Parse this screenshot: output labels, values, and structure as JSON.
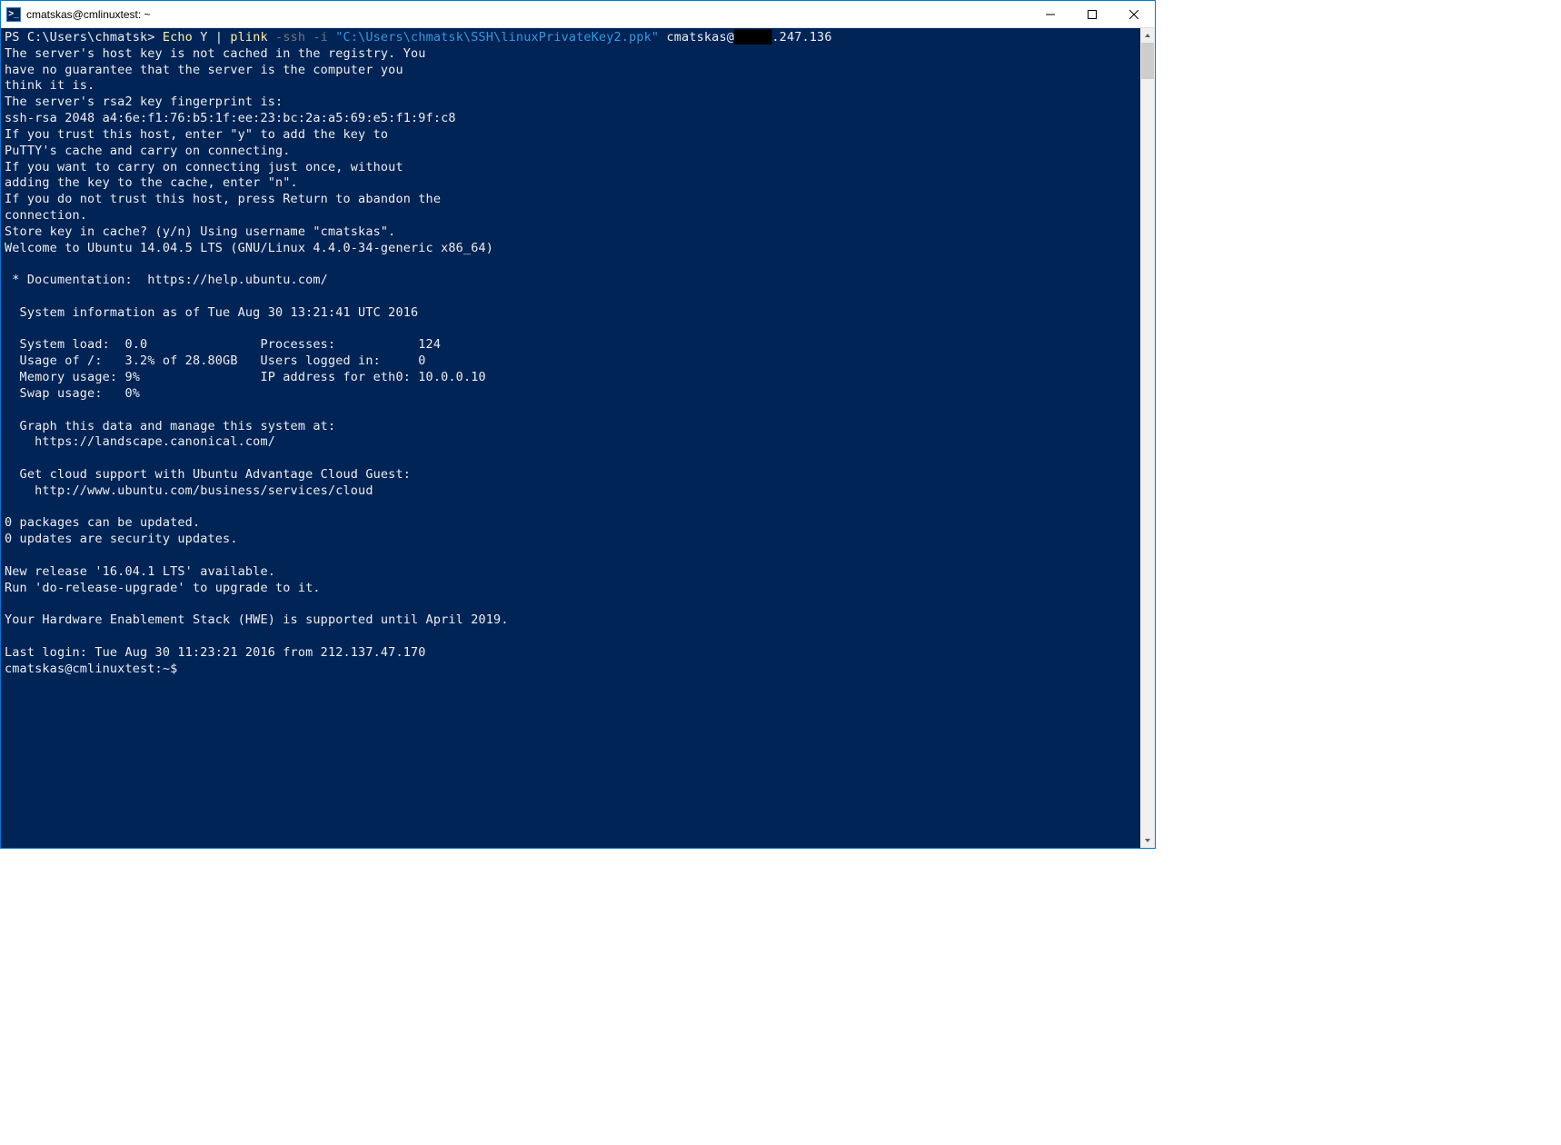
{
  "window": {
    "title": "cmatskas@cmlinuxtest: ~",
    "icon_glyph": ">_"
  },
  "prompt": {
    "ps": "PS C:\\Users\\chmatsk> ",
    "echo": "Echo",
    "y": " Y ",
    "pipe": "| ",
    "plink": "plink",
    "args1": " -ssh -i ",
    "keypath": "\"C:\\Users\\chmatsk\\SSH\\linuxPrivateKey2.ppk\"",
    "user_at": " cmatskas@",
    "redacted": "█████",
    "ip_suffix": ".247.136"
  },
  "lines": {
    "l1": "The server's host key is not cached in the registry. You",
    "l2": "have no guarantee that the server is the computer you",
    "l3": "think it is.",
    "l4": "The server's rsa2 key fingerprint is:",
    "l5": "ssh-rsa 2048 a4:6e:f1:76:b5:1f:ee:23:bc:2a:a5:69:e5:f1:9f:c8",
    "l6": "If you trust this host, enter \"y\" to add the key to",
    "l7": "PuTTY's cache and carry on connecting.",
    "l8": "If you want to carry on connecting just once, without",
    "l9": "adding the key to the cache, enter \"n\".",
    "l10": "If you do not trust this host, press Return to abandon the",
    "l11": "connection.",
    "l12": "Store key in cache? (y/n) Using username \"cmatskas\".",
    "l13": "Welcome to Ubuntu 14.04.5 LTS (GNU/Linux 4.4.0-34-generic x86_64)",
    "l14": "",
    "l15": " * Documentation:  https://help.ubuntu.com/",
    "l16": "",
    "l17": "  System information as of Tue Aug 30 13:21:41 UTC 2016",
    "l18": "",
    "l19": "  System load:  0.0               Processes:           124",
    "l20": "  Usage of /:   3.2% of 28.80GB   Users logged in:     0",
    "l21": "  Memory usage: 9%                IP address for eth0: 10.0.0.10",
    "l22": "  Swap usage:   0%",
    "l23": "",
    "l24": "  Graph this data and manage this system at:",
    "l25": "    https://landscape.canonical.com/",
    "l26": "",
    "l27": "  Get cloud support with Ubuntu Advantage Cloud Guest:",
    "l28": "    http://www.ubuntu.com/business/services/cloud",
    "l29": "",
    "l30": "0 packages can be updated.",
    "l31": "0 updates are security updates.",
    "l32": "",
    "l33": "New release '16.04.1 LTS' available.",
    "l34": "Run 'do-release-upgrade' to upgrade to it.",
    "l35": "",
    "l36": "Your Hardware Enablement Stack (HWE) is supported until April 2019.",
    "l37": "",
    "l38": "Last login: Tue Aug 30 11:23:21 2016 from 212.137.47.170",
    "l39": "cmatskas@cmlinuxtest:~$"
  }
}
